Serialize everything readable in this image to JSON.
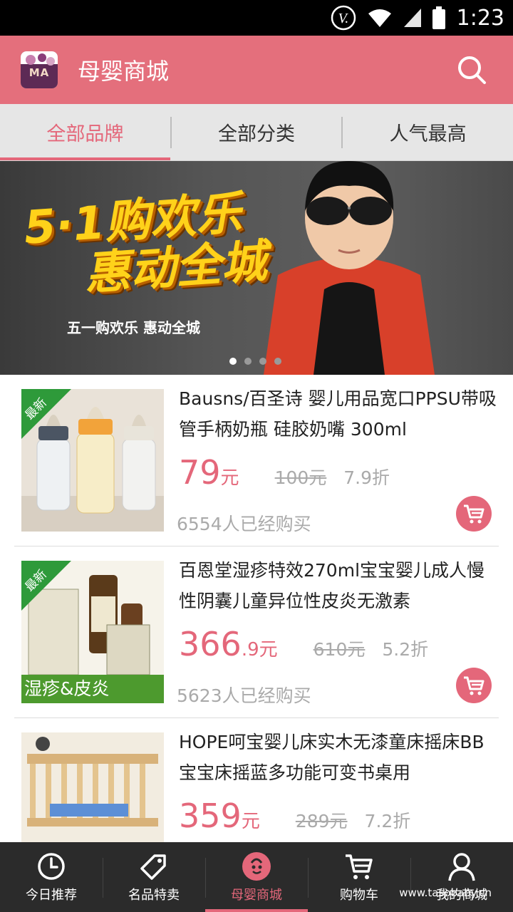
{
  "status_bar": {
    "time": "1:23",
    "icons": [
      "v-icon",
      "wifi-icon",
      "signal-icon",
      "battery-icon"
    ]
  },
  "app_bar": {
    "title": "母婴商城",
    "logo_text": "MA",
    "search_icon": "search-icon"
  },
  "tabs": [
    {
      "label": "全部品牌",
      "active": true
    },
    {
      "label": "全部分类",
      "active": false
    },
    {
      "label": "人气最高",
      "active": false
    }
  ],
  "banner": {
    "headline_line1": "5·1购欢乐",
    "headline_line2": "惠动全城",
    "subtitle": "五一购欢乐 惠动全城",
    "page_count": 4,
    "active_index": 0
  },
  "products": [
    {
      "badge": "最新",
      "name": "Bausns/百圣诗 婴儿用品宽口PPSU带吸管手柄奶瓶 硅胶奶嘴 300ml",
      "price_int": "79",
      "price_dec": "",
      "unit": "元",
      "original": "100元",
      "discount": "7.9折",
      "sold": "6554人已经购买"
    },
    {
      "badge": "最新",
      "name": "百恩堂湿疹特效270ml宝宝婴儿成人慢性阴囊儿童异位性皮炎无激素",
      "price_int": "366",
      "price_dec": ".9",
      "unit": "元",
      "original": "610元",
      "discount": "5.2折",
      "sold": "5623人已经购买",
      "image_caption": "湿疹&皮炎"
    },
    {
      "badge": "",
      "name": "HOPE呵宝婴儿床实木无漆童床摇床BB宝宝床摇蓝多功能可变书桌用",
      "price_int": "359",
      "price_dec": "",
      "unit": "元",
      "original": "289元",
      "discount": "7.2折",
      "sold": ""
    }
  ],
  "bottom_nav": [
    {
      "label": "今日推荐",
      "icon": "clock-icon",
      "active": false
    },
    {
      "label": "名品特卖",
      "icon": "tag-icon",
      "active": false
    },
    {
      "label": "母婴商城",
      "icon": "baby-icon",
      "active": true
    },
    {
      "label": "购物车",
      "icon": "cart-icon",
      "active": false
    },
    {
      "label": "我的商城",
      "icon": "user-icon",
      "active": false
    }
  ],
  "watermark": "www.tasobaby.cn"
}
